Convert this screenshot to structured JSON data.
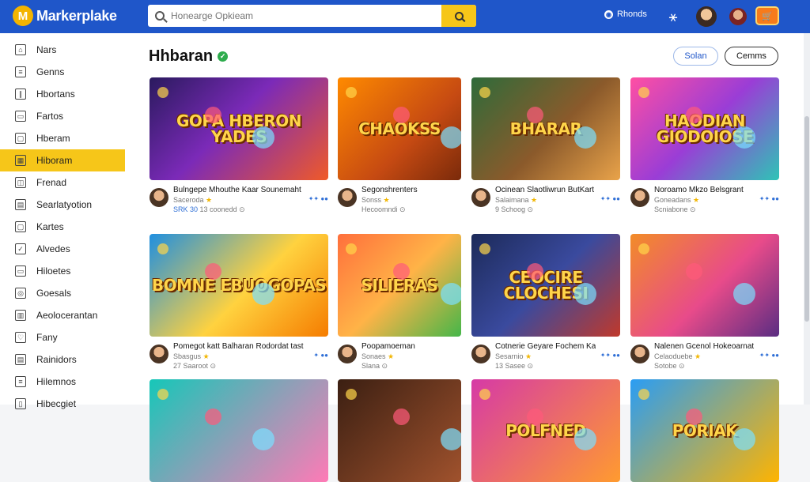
{
  "app": {
    "logo_letter": "M",
    "logo_text": "Markerplake"
  },
  "search": {
    "placeholder": "Honearge Opkieam"
  },
  "topbar": {
    "link_label": "Rhonds",
    "cart_label": "🛒"
  },
  "sidebar": {
    "items": [
      {
        "label": "Nars",
        "icon": "home-icon",
        "glyph": "⌂"
      },
      {
        "label": "Genns",
        "icon": "list-icon",
        "glyph": "≡"
      },
      {
        "label": "Hbortans",
        "icon": "book-icon",
        "glyph": "∥"
      },
      {
        "label": "Fartos",
        "icon": "folder-icon",
        "glyph": "▭"
      },
      {
        "label": "Hberam",
        "icon": "tag-icon",
        "glyph": "▢"
      },
      {
        "label": "Hiboram",
        "icon": "grid-icon",
        "glyph": "▦",
        "active": true
      },
      {
        "label": "Frenad",
        "icon": "layers-icon",
        "glyph": "◫"
      },
      {
        "label": "Searlatyotion",
        "icon": "calendar-icon",
        "glyph": "▤"
      },
      {
        "label": "Kartes",
        "icon": "box-icon",
        "glyph": "▢"
      },
      {
        "label": "Alvedes",
        "icon": "check-icon",
        "glyph": "✓"
      },
      {
        "label": "Hiloetes",
        "icon": "note-icon",
        "glyph": "▭"
      },
      {
        "label": "Goesals",
        "icon": "target-icon",
        "glyph": "◎"
      },
      {
        "label": "Aeolocerantan",
        "icon": "chart-icon",
        "glyph": "▥"
      },
      {
        "label": "Fany",
        "icon": "heart-icon",
        "glyph": "♡"
      },
      {
        "label": "Rainidors",
        "icon": "calendar-icon",
        "glyph": "▤"
      },
      {
        "label": "Hilemnos",
        "icon": "sliders-icon",
        "glyph": "≡"
      },
      {
        "label": "Hibecgiet",
        "icon": "file-icon",
        "glyph": "▯"
      }
    ]
  },
  "main": {
    "title": "Hhbaran",
    "buttons": {
      "primary": "Solan",
      "secondary": "Cemms"
    }
  },
  "cards": [
    {
      "banner": "GOPA HBERON YADES",
      "title": "Bulngepe Mhouthe Kaar Sounemaht Solupborso",
      "sub": "Saceroda",
      "meta": "13 coonedd",
      "price": "SRK 30",
      "rating": "✦✦ ●●"
    },
    {
      "banner": "CHAOKSS",
      "title": "Segonshrenters",
      "sub": "Sonss",
      "meta": "Hecoomndi",
      "price": "",
      "rating": ""
    },
    {
      "banner": "BHARAR",
      "title": "Ocinean Slaotliwrun ButKart",
      "sub": "Salaimana",
      "meta": "9 Schoog",
      "price": "",
      "rating": "✦✦ ●●"
    },
    {
      "banner": "HAODIAN GIODOIOSE",
      "title": "Noroamo Mkzo Belsgrant",
      "sub": "Goneadans",
      "meta": "Scniabone",
      "price": "",
      "rating": "✦✦ ●●"
    },
    {
      "banner": "BOMNE EBUOGOPAS",
      "title": "Pomegot katt Balharan Rodordat tast",
      "sub": "Sbasgus",
      "meta": "27 Saaroot",
      "price": "",
      "rating": "✦ ●●"
    },
    {
      "banner": "SILIERAS",
      "title": "Poopamoeman",
      "sub": "Sonaes",
      "meta": "Slana",
      "price": "",
      "rating": ""
    },
    {
      "banner": "CEOCIRE CLOCHESI",
      "title": "Cotnerie Geyare Fochem Kas Solenodsan",
      "sub": "Sesarnio",
      "meta": "13 Sasee",
      "price": "",
      "rating": "✦✦ ●●"
    },
    {
      "banner": "",
      "title": "Nalenen Gcenol Hokeoarnat",
      "sub": "Celaoduebe",
      "meta": "Sotobe",
      "price": "",
      "rating": "✦✦ ●●"
    },
    {
      "banner": "",
      "title": "",
      "sub": "",
      "meta": "",
      "price": "",
      "rating": ""
    },
    {
      "banner": "",
      "title": "",
      "sub": "",
      "meta": "",
      "price": "",
      "rating": ""
    },
    {
      "banner": "POLFNED",
      "title": "",
      "sub": "",
      "meta": "",
      "price": "",
      "rating": ""
    },
    {
      "banner": "PORIAK",
      "title": "",
      "sub": "",
      "meta": "",
      "price": "",
      "rating": ""
    }
  ],
  "colors": {
    "brand": "#1f56c9",
    "accent": "#f6c619",
    "verified": "#2eac4d"
  }
}
